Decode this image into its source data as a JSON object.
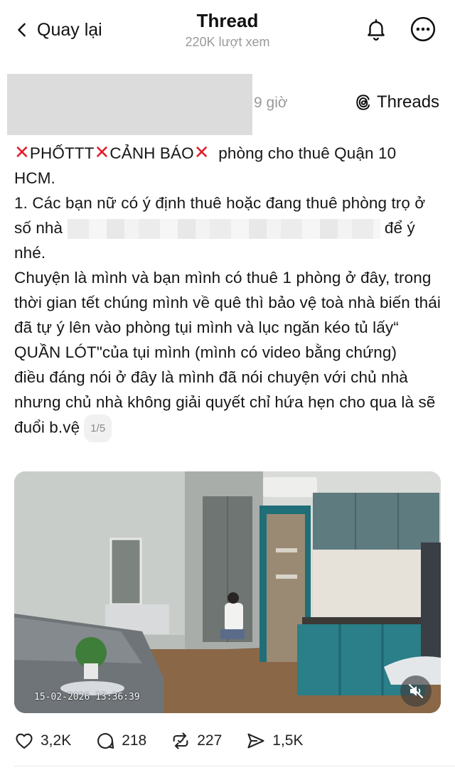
{
  "header": {
    "back_label": "Quay lại",
    "title": "Thread",
    "views": "220K lượt xem"
  },
  "post": {
    "time": "9 giờ",
    "source": "Threads",
    "line1_tag": "PHỐTTT",
    "line1_tag2": "CẢNH BÁO",
    "line1_rest": "phòng cho thuê Quận 10 HCM.",
    "para1_start": "1. Các bạn nữ có ý định thuê hoặc đang thuê phòng trọ ở số nhà",
    "para1_end": "để ý nhé.",
    "para2": "Chuyện là mình và bạn mình có thuê 1 phòng ở đây, trong thời gian tết chúng mình về quê thì bảo vệ toà nhà biến thái đã tự ý lên vào phòng tụi mình và lục ngăn kéo tủ lấy“ QUẦN LÓT\"của tụi mình (mình có video bằng chứng)",
    "para3": "điều đáng nói ở đây là mình đã nói chuyện với chủ nhà nhưng chủ nhà không giải quyết chỉ hứa hẹn cho qua là sẽ đuổi b.vệ",
    "page_indicator": "1/5",
    "photo_timestamp": "15-02-2026 13:36:39"
  },
  "actions": {
    "likes": "3,2K",
    "comments": "218",
    "reposts": "227",
    "shares": "1,5K"
  },
  "icons": {
    "back": "chevron-left-icon",
    "bell": "bell-icon",
    "more": "more-icon",
    "threads": "threads-logo-icon",
    "mute": "muted-speaker-icon",
    "like": "heart-icon",
    "comment": "comment-icon",
    "repost": "repost-icon",
    "share": "send-icon"
  },
  "colors": {
    "accent_red": "#e11d2a",
    "muted_text": "#9a9a9a"
  }
}
